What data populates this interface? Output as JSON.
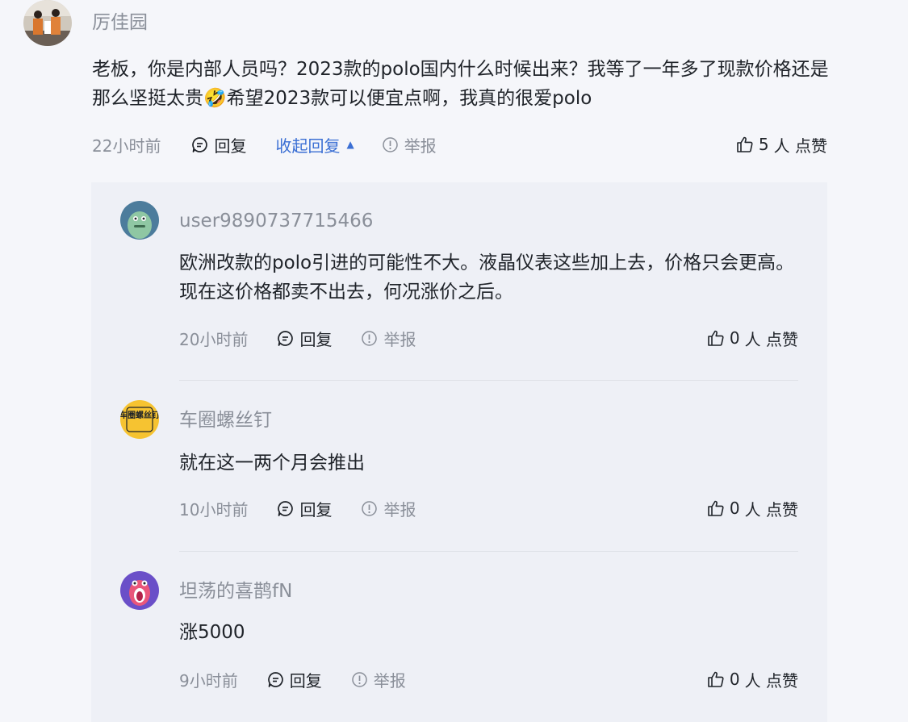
{
  "comment": {
    "username": "厉佳园",
    "content": "老板，你是内部人员吗？2023款的polo国内什么时候出来？我等了一年多了现款价格还是那么坚挺太贵🤣希望2023款可以便宜点啊，我真的很爱polo",
    "time": "22小时前",
    "reply_label": "回复",
    "collapse_label": "收起回复",
    "report_label": "举报",
    "likes": "5",
    "likes_unit": "人 点赞"
  },
  "replies": [
    {
      "username": "user9890737715466",
      "content": "欧洲改款的polo引进的可能性不大。液晶仪表这些加上去，价格只会更高。现在这价格都卖不出去，何况涨价之后。",
      "time": "20小时前",
      "reply_label": "回复",
      "report_label": "举报",
      "likes": "0",
      "likes_unit": "人 点赞"
    },
    {
      "username": "车圈螺丝钉",
      "avatar_text": "车圈螺丝钉",
      "content": "就在这一两个月会推出",
      "time": "10小时前",
      "reply_label": "回复",
      "report_label": "举报",
      "likes": "0",
      "likes_unit": "人 点赞"
    },
    {
      "username": "坦荡的喜鹊fN",
      "content": "涨5000",
      "time": "9小时前",
      "reply_label": "回复",
      "report_label": "举报",
      "likes": "0",
      "likes_unit": "人 点赞"
    }
  ],
  "colors": {
    "page_bg": "#f5f6fa",
    "panel_bg": "#eef0f6",
    "link": "#3b6fd4",
    "muted": "#8a8f99",
    "text": "#1f2329"
  }
}
